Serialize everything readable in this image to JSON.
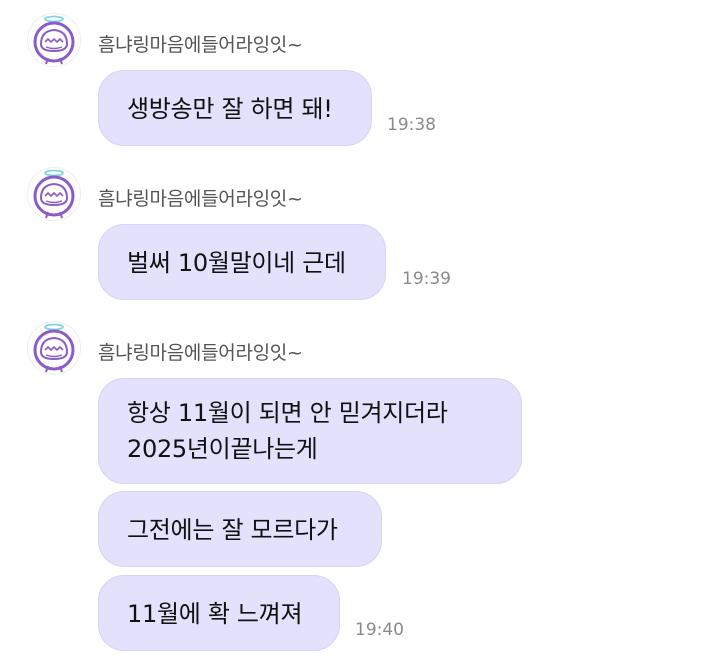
{
  "groups": [
    {
      "sender": "흠냐링마음에들어라잉잇~",
      "messages": [
        {
          "lines": [
            "생방송만 잘 하면 돼!"
          ],
          "time": "19:38"
        }
      ]
    },
    {
      "sender": "흠냐링마음에들어라잉잇~",
      "messages": [
        {
          "lines": [
            "벌써 10월말이네 근데"
          ],
          "time": "19:39"
        }
      ]
    },
    {
      "sender": "흠냐링마음에들어라잉잇~",
      "messages": [
        {
          "lines": [
            "항상 11월이 되면 안 믿겨지더라",
            "2025년이끝나는게"
          ],
          "time": ""
        },
        {
          "lines": [
            "그전에는 잘 모르다가"
          ],
          "time": ""
        },
        {
          "lines": [
            "11월에 확 느껴져"
          ],
          "time": "19:40"
        }
      ]
    }
  ],
  "avatar_icon": "halo-character-icon",
  "colors": {
    "bubble": "#e3e1fb",
    "avatar_purple": "#8b5cc8",
    "halo": "#7fd6e0"
  }
}
